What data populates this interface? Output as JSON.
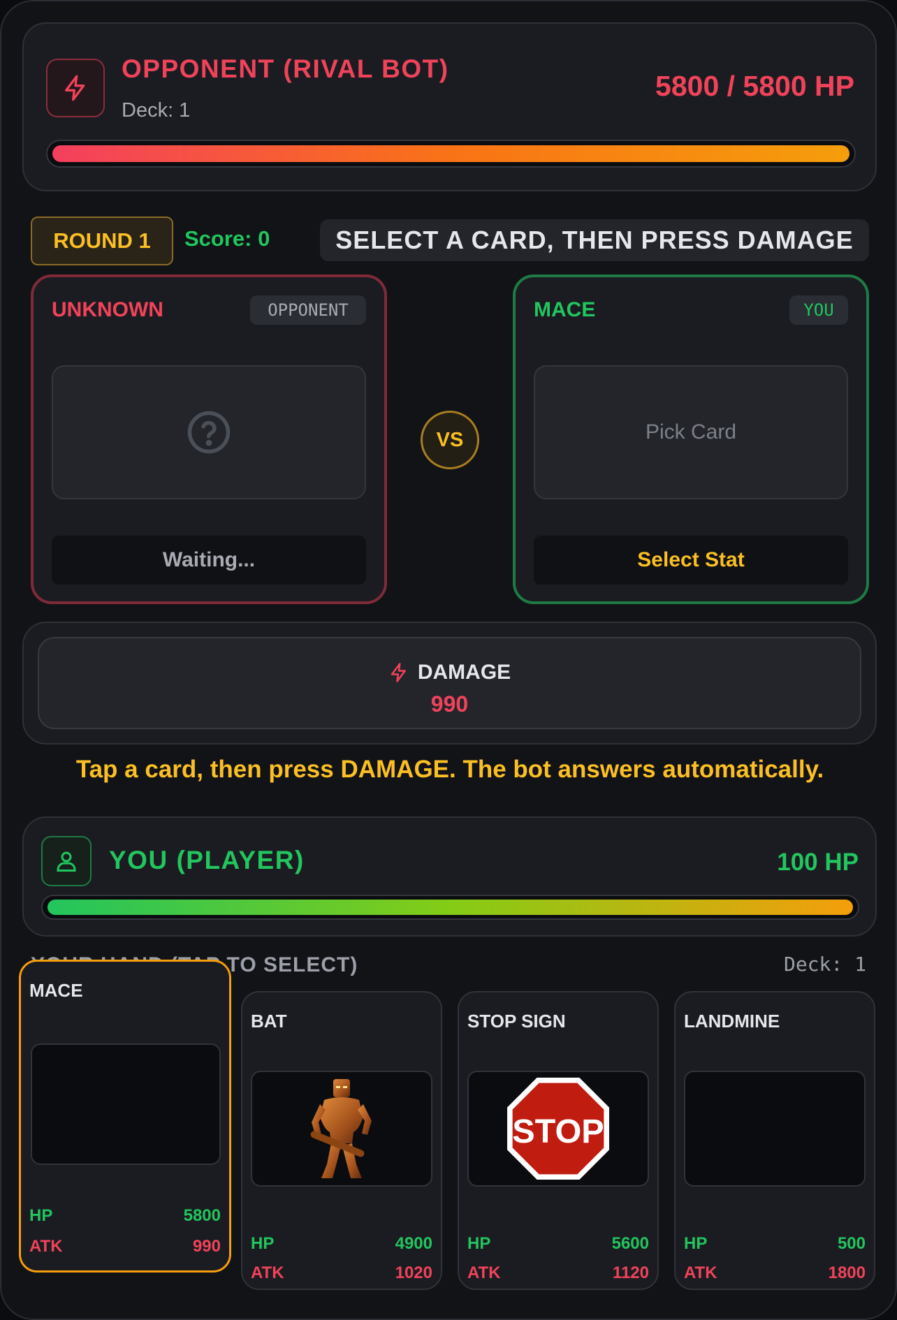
{
  "opponent": {
    "title": "OPPONENT (RIVAL BOT)",
    "deck": "Deck: 1",
    "hp_text": "5800 / 5800 HP",
    "hp_fraction": 1.0
  },
  "round": {
    "label": "ROUND 1",
    "score": "Score: 0",
    "instruction": "SELECT A CARD, THEN PRESS DAMAGE"
  },
  "battle": {
    "opponent_card": {
      "name": "UNKNOWN",
      "tag": "OPPONENT",
      "status": "Waiting..."
    },
    "vs": "VS",
    "player_card": {
      "name": "MACE",
      "tag": "YOU",
      "art_text": "Pick Card",
      "status": "Select Stat"
    }
  },
  "damage": {
    "label": "DAMAGE",
    "value": "990"
  },
  "hint": "Tap a card, then press DAMAGE. The bot answers automatically.",
  "player": {
    "title": "YOU (PLAYER)",
    "hp_text": "100 HP",
    "hp_fraction": 1.0
  },
  "hand": {
    "label": "YOUR HAND (TAP TO SELECT)",
    "deck": "Deck: 1",
    "cards": [
      {
        "name": "MACE",
        "hp_label": "HP",
        "hp": "5800",
        "atk_label": "ATK",
        "atk": "990",
        "selected": true,
        "art": "empty"
      },
      {
        "name": "BAT",
        "hp_label": "HP",
        "hp": "4900",
        "atk_label": "ATK",
        "atk": "1020",
        "selected": false,
        "art": "bat-warrior-figure"
      },
      {
        "name": "STOP SIGN",
        "hp_label": "HP",
        "hp": "5600",
        "atk_label": "ATK",
        "atk": "1120",
        "selected": false,
        "art": "stop-sign",
        "art_text": "STOP"
      },
      {
        "name": "LANDMINE",
        "hp_label": "HP",
        "hp": "500",
        "atk_label": "ATK",
        "atk": "1800",
        "selected": false,
        "art": "empty"
      }
    ]
  },
  "colors": {
    "opponent": "#f0435a",
    "player": "#22c55e",
    "accent": "#fbbf24"
  }
}
